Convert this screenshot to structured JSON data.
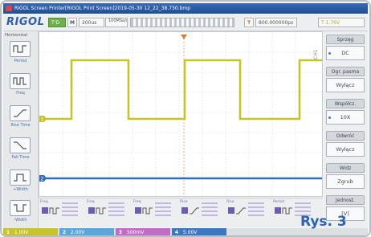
{
  "window": {
    "title": "RIGOL Screen Printer[RIGOL Print Screen]2019-05-30 12_22_38.730.bmp"
  },
  "toolbar": {
    "logo": "RIGOL",
    "mode": "T'D",
    "menu": "M",
    "timebase": "200us",
    "sample": "100MSa/s 1.2Mpts",
    "trig_position": "800.000000ps",
    "trig_marker": "T",
    "trig_source": "T",
    "trig_level": "1.76V"
  },
  "left_panel": {
    "title": "Horizontal",
    "items": [
      "Period",
      "Freq",
      "Rise Time",
      "Fall Time",
      "+Width",
      "-Width"
    ]
  },
  "screen": {
    "ch1_marker": "1",
    "ch2_marker": "2",
    "side_label": "CH1"
  },
  "right_panel": {
    "groups": [
      {
        "head": "Sprzęg",
        "value": "DC"
      },
      {
        "head": "Ogr. pasma",
        "value": "Wyłącz"
      },
      {
        "head": "Współcz.",
        "value": "10X"
      },
      {
        "head": "Odwróć",
        "value": "Wyłącz"
      },
      {
        "head": "Widz",
        "value": "Zgrub"
      },
      {
        "head": "Jednost.",
        "value": "[V]"
      }
    ]
  },
  "measurements": {
    "labels": [
      "Freq",
      "Freq",
      "Freq",
      "Rise",
      "Rise",
      "Period"
    ]
  },
  "channels": [
    {
      "num": "1",
      "scale": "1.00V",
      "color": "#c8c327"
    },
    {
      "num": "2",
      "scale": "2.00V",
      "color": "#5aa7dd"
    },
    {
      "num": "3",
      "scale": "500mV",
      "color": "#c46bc8"
    },
    {
      "num": "4",
      "scale": "5.00V",
      "color": "#3a78c3"
    }
  ],
  "caption": "Rys. 3",
  "colors": {
    "ch1": "#c8c327",
    "ch2": "#2f6dc0",
    "trigger": "#e07a24",
    "grid": "#d0d4d8"
  }
}
